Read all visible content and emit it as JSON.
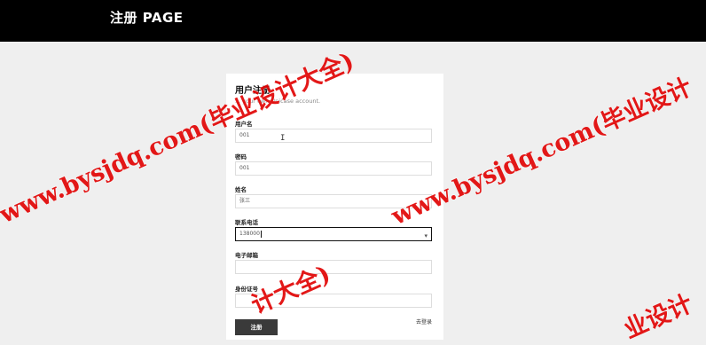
{
  "header": {
    "title": "注册 PAGE"
  },
  "form": {
    "heading": "用户注册",
    "subtitle": "... your own Unicase account.",
    "fields": [
      {
        "label": "用户名",
        "value": "001"
      },
      {
        "label": "密码",
        "value": "001"
      },
      {
        "label": "姓名",
        "value": "张三"
      },
      {
        "label": "联系电话",
        "value": "138000"
      },
      {
        "label": "电子邮箱",
        "value": ""
      },
      {
        "label": "身份证号",
        "value": ""
      }
    ],
    "submit_label": "注册",
    "login_link": "去登录"
  },
  "watermark": {
    "text": "www.bysjdq.com(毕业设计大全)",
    "fragment_right": "www.bysjdq.com(毕业设计",
    "fragment_bottom": "计大全)",
    "fragment_corner": "业设计",
    "color": "#e10000"
  },
  "colors": {
    "topbar": "#000000",
    "background": "#efefef",
    "button": "#3a3a3a"
  }
}
